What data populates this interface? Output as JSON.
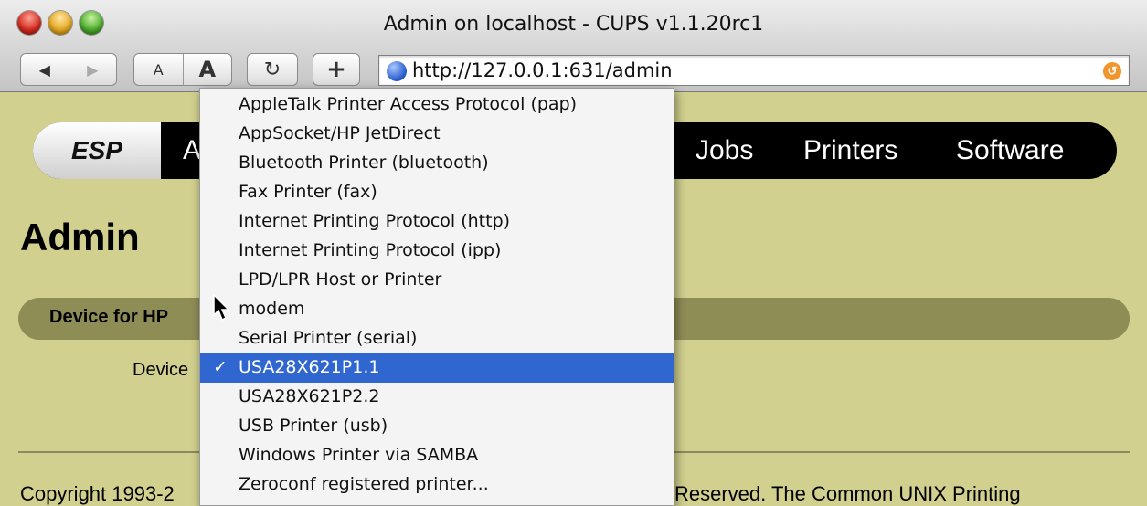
{
  "window": {
    "title": "Admin on localhost - CUPS v1.1.20rc1"
  },
  "toolbar": {
    "back_icon": "◀",
    "forward_icon": "▶",
    "text_smaller": "A",
    "text_bigger": "A",
    "reload_icon": "↻",
    "add_icon": "+"
  },
  "address": {
    "url": "http://127.0.0.1:631/admin",
    "rss_icon": "↺"
  },
  "nav": {
    "logo": "ESP",
    "partial_admin": "A",
    "items": [
      "Jobs",
      "Printers",
      "Software"
    ]
  },
  "page": {
    "heading": "Admin",
    "section_label": "Device for HP",
    "device_label": "Device",
    "copyright_left": "Copyright 1993-2",
    "copyright_right": "Reserved. The Common UNIX Printing"
  },
  "menu": {
    "check": "✓",
    "items": [
      "AppleTalk Printer Access Protocol (pap)",
      "AppSocket/HP JetDirect",
      "Bluetooth Printer (bluetooth)",
      "Fax Printer (fax)",
      "Internet Printing Protocol (http)",
      "Internet Printing Protocol (ipp)",
      "LPD/LPR Host or Printer",
      "modem",
      "Serial Printer (serial)",
      "USA28X621P1.1",
      "USA28X621P2.2",
      "USB Printer (usb)",
      "Windows Printer via SAMBA",
      "Zeroconf registered printer..."
    ],
    "selected_index": 9
  },
  "colors": {
    "page_background": "#d1d08e",
    "section_bar": "#8f8d56",
    "selection_blue": "#2f66d0",
    "navbar": "#000000"
  }
}
